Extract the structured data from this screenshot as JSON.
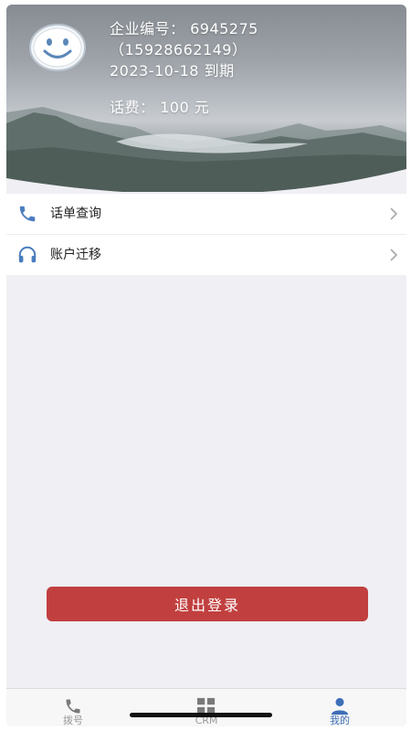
{
  "header": {
    "company_line": "企业编号： 6945275",
    "phone_line": "（15928662149）",
    "expiry_line": "2023-10-18 到期",
    "fee_line": "话费： 100 元"
  },
  "menu": {
    "items": [
      {
        "label": "话单查询",
        "icon": "phone-icon"
      },
      {
        "label": "账户迁移",
        "icon": "headset-icon"
      }
    ]
  },
  "logout": {
    "label": "退出登录"
  },
  "tabbar": {
    "tabs": [
      {
        "label": "拨号",
        "icon": "phone-icon",
        "active": false
      },
      {
        "label": "CRM",
        "icon": "grid-icon",
        "active": false
      },
      {
        "label": "我的",
        "icon": "person-icon",
        "active": true
      }
    ]
  },
  "colors": {
    "accent": "#3d6fb7",
    "logout": "#c1403f",
    "background": "#efeff4"
  }
}
